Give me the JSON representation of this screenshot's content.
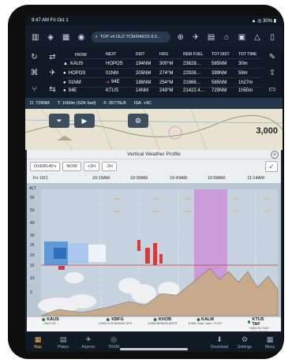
{
  "status": {
    "time": "9:47 AM",
    "date": "Fri Oct 1",
    "battery": "30%"
  },
  "toolbar": {
    "search_text": "TOP v4 OLD TCM/040/20 8,0…",
    "icons": [
      "sidebar-icon",
      "layers-icon",
      "grid-icon",
      "user-icon",
      "globe-icon",
      "plane-icon",
      "profile-icon",
      "route-icon",
      "cube-icon",
      "clip-icon",
      "trash-icon",
      "warning-icon",
      "doc-icon"
    ]
  },
  "navlog": {
    "headers": [
      "FROM",
      "NEXT",
      "DIST",
      "HDG",
      "REM FUEL",
      "TOT DIST",
      "TOT TIME"
    ],
    "rows": [
      {
        "from": "KAUS",
        "next": "HOPOS",
        "dist": "194NM",
        "hdg": "300°M",
        "rem_fuel": "23828…",
        "tot_dist": "585NM",
        "tot_time": "30m"
      },
      {
        "from": "HOPOS",
        "next": "01NM",
        "dist": "205NM",
        "hdg": "274°M",
        "rem_fuel": "22926…",
        "tot_dist": "399NM",
        "tot_time": "59m"
      },
      {
        "from": "01NM",
        "next": "94E",
        "dist": "186NM",
        "hdg": "254°M",
        "rem_fuel": "21966…",
        "tot_dist": "585NM",
        "tot_time": "1h27m"
      },
      {
        "from": "94E",
        "next": "KTUS",
        "dist": "14NM",
        "hdg": "249°M",
        "rem_fuel": "21422.4…",
        "tot_dist": "729NM",
        "tot_time": "1h50m"
      }
    ]
  },
  "info": {
    "d": "D: 729NM",
    "t": "T: 1h50m (S2K fuel)",
    "f": "F: 35776LB",
    "isa": "ISA: +9C"
  },
  "map": {
    "altitude": "3,000"
  },
  "panel": {
    "title": "Vertical Weather Profile",
    "overlays_label": "OVERLAYs",
    "now_label": "NOW",
    "plus2h_label": "+2H",
    "minus2h_label": "-2H",
    "date": "Fri 10/1",
    "times": [
      "10:15AM",
      "10:30AM",
      "10:43AM",
      "10:58AM",
      "11:14AM"
    ],
    "alt_label": "ALT",
    "alt_ticks": [
      "60",
      "50",
      "40",
      "30",
      "25",
      "20",
      "15",
      "10",
      "5"
    ],
    "waypoints": [
      {
        "name": "KAUS",
        "sub": "--SM CLR\n--",
        "color": "#2e7d32"
      },
      {
        "name": "KBFG",
        "sub": "10SM CLR BKN040\nVFR",
        "color": "#2e7d32"
      },
      {
        "name": "KHOB",
        "sub": "10SM BKN025\nMVFR",
        "color": "#2e7d32"
      },
      {
        "name": "KALM",
        "sub": "10SM Clear\nCalm +FCST",
        "color": "#2e7d32"
      },
      {
        "name": "KTUS TAF",
        "sub": "+6SM SCT100\n150°@08KT",
        "color": "#2e7d32"
      }
    ]
  },
  "tabs": [
    {
      "label": "Map",
      "icon": "map-icon",
      "active": true
    },
    {
      "label": "Plates",
      "icon": "plates-icon",
      "active": false
    },
    {
      "label": "Airports",
      "icon": "airports-icon",
      "active": false
    },
    {
      "label": "TRXM",
      "icon": "trxm-icon",
      "active": false
    },
    {
      "label": "Download",
      "icon": "download-icon",
      "active": false
    },
    {
      "label": "Settings",
      "icon": "settings-icon",
      "active": false
    },
    {
      "label": "Menu",
      "icon": "menu-icon",
      "active": false
    }
  ],
  "colors": {
    "accent": "#f0b84a",
    "terrain": "#c7a98c",
    "clouds": "#ffffff",
    "icing_blue": "#4f8fd6",
    "turb_red": "#d43d3d",
    "restricted": "#cf6bd6"
  }
}
